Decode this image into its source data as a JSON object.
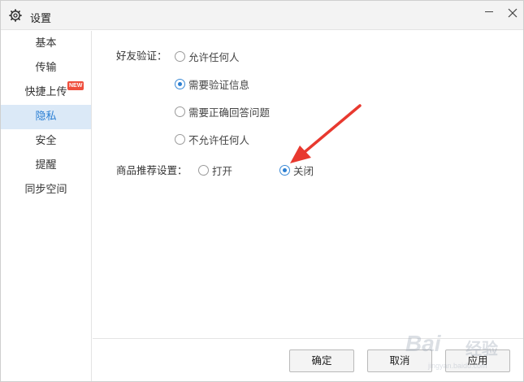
{
  "window": {
    "title": "设置"
  },
  "sidebar": {
    "items": [
      {
        "label": "基本",
        "active": false
      },
      {
        "label": "传输",
        "active": false
      },
      {
        "label": "快捷上传",
        "active": false,
        "badge": "NEW"
      },
      {
        "label": "隐私",
        "active": true
      },
      {
        "label": "安全",
        "active": false
      },
      {
        "label": "提醒",
        "active": false
      },
      {
        "label": "同步空间",
        "active": false
      }
    ]
  },
  "privacy": {
    "friend_verify": {
      "label": "好友验证：",
      "options": [
        {
          "label": "允许任何人",
          "checked": false
        },
        {
          "label": "需要验证信息",
          "checked": true
        },
        {
          "label": "需要正确回答问题",
          "checked": false
        },
        {
          "label": "不允许任何人",
          "checked": false
        }
      ]
    },
    "product_recommend": {
      "label": "商品推荐设置：",
      "options": [
        {
          "label": "打开",
          "checked": false
        },
        {
          "label": "关闭",
          "checked": true
        }
      ]
    }
  },
  "footer": {
    "ok": "确定",
    "cancel": "取消",
    "apply": "应用"
  },
  "colors": {
    "accent": "#2a7fd4",
    "active_bg": "#dbe9f7",
    "badge": "#ef4e3c",
    "annotation_arrow": "#e8392f"
  },
  "watermark": {
    "brand": "Bai",
    "brand2": "经验",
    "sub": "jingyan.baidu.com"
  }
}
